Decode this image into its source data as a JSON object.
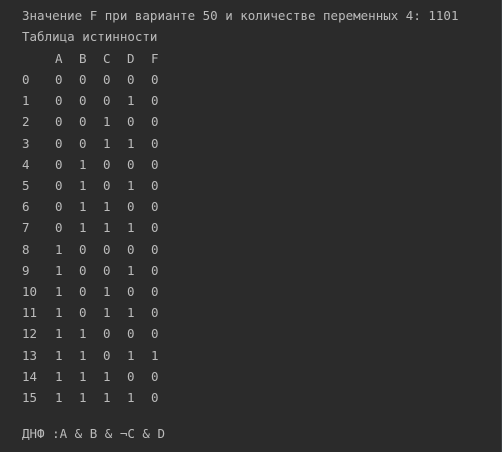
{
  "console": {
    "header_line": "Значение F при варианте 50 и количестве переменных 4: 1101",
    "table_title": "Таблица истинности",
    "columns": [
      "A",
      "B",
      "C",
      "D",
      "F"
    ],
    "rows": [
      [
        "0",
        "0",
        "0",
        "0",
        "0",
        "0"
      ],
      [
        "1",
        "0",
        "0",
        "0",
        "1",
        "0"
      ],
      [
        "2",
        "0",
        "0",
        "1",
        "0",
        "0"
      ],
      [
        "3",
        "0",
        "0",
        "1",
        "1",
        "0"
      ],
      [
        "4",
        "0",
        "1",
        "0",
        "0",
        "0"
      ],
      [
        "5",
        "0",
        "1",
        "0",
        "1",
        "0"
      ],
      [
        "6",
        "0",
        "1",
        "1",
        "0",
        "0"
      ],
      [
        "7",
        "0",
        "1",
        "1",
        "1",
        "0"
      ],
      [
        "8",
        "1",
        "0",
        "0",
        "0",
        "0"
      ],
      [
        "9",
        "1",
        "0",
        "0",
        "1",
        "0"
      ],
      [
        "10",
        "1",
        "0",
        "1",
        "0",
        "0"
      ],
      [
        "11",
        "1",
        "0",
        "1",
        "1",
        "0"
      ],
      [
        "12",
        "1",
        "1",
        "0",
        "0",
        "0"
      ],
      [
        "13",
        "1",
        "1",
        "0",
        "1",
        "1"
      ],
      [
        "14",
        "1",
        "1",
        "1",
        "0",
        "0"
      ],
      [
        "15",
        "1",
        "1",
        "1",
        "1",
        "0"
      ]
    ],
    "dnf_line": "ДНФ :A & B & ¬C & D"
  },
  "colors": {
    "background": "#2b2b2b",
    "text": "#bbbbbb"
  }
}
